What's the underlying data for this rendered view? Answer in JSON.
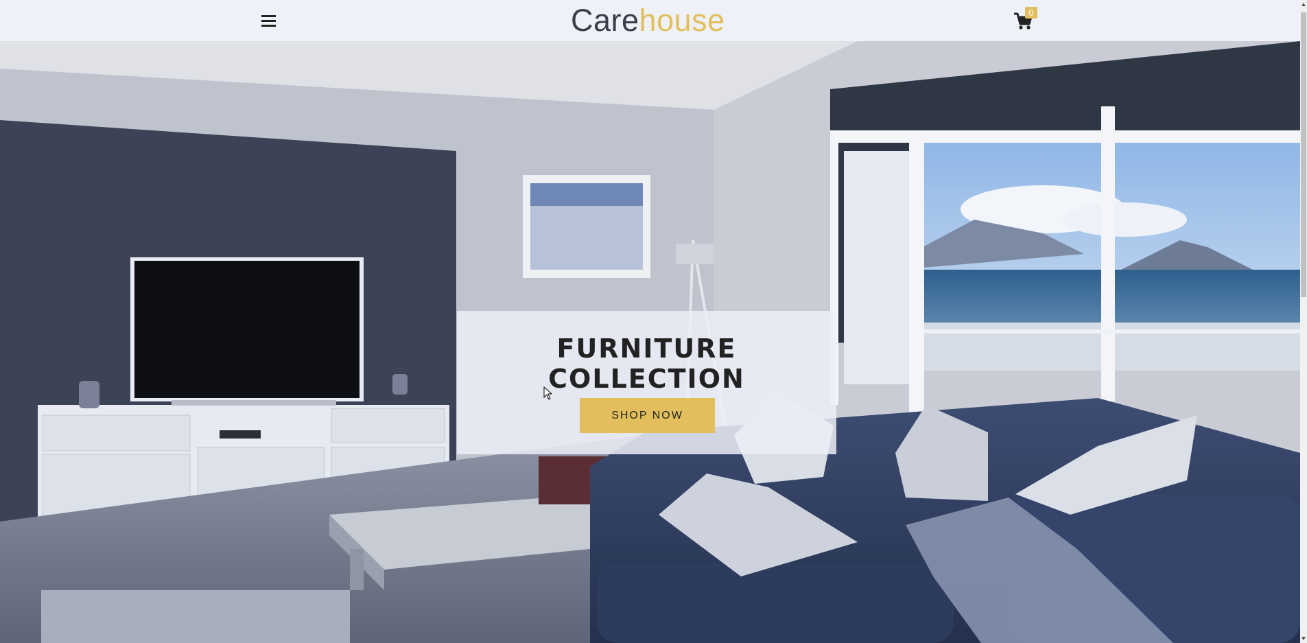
{
  "header": {
    "logo_part1": "Care",
    "logo_part2": "house",
    "cart_count": "0",
    "icons": {
      "menu": "hamburger-menu-icon",
      "cart": "shopping-cart-icon"
    }
  },
  "hero": {
    "title": "FURNITURE COLLECTION",
    "cta_label": "SHOP NOW"
  },
  "colors": {
    "accent": "#e2bf5c",
    "header_bg": "#eef1f8",
    "text_dark": "#222222",
    "logo_dark": "#3a3d4a"
  }
}
